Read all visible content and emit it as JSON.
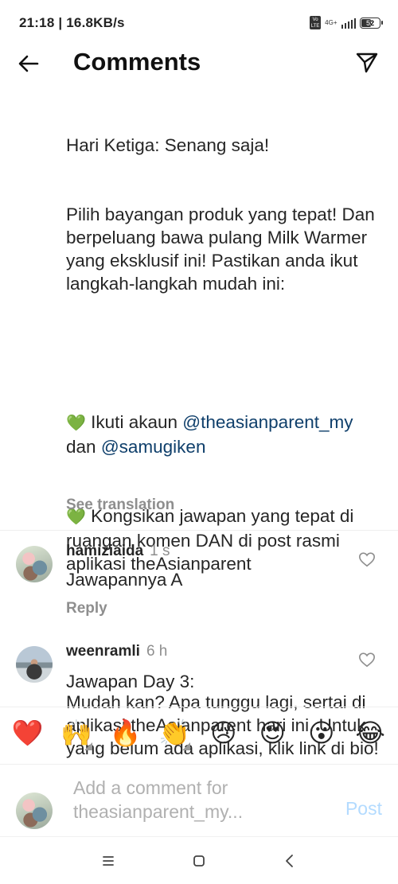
{
  "status": {
    "time_speed": "21:18 | 16.8KB/s",
    "network": "4G+",
    "battery": "52"
  },
  "header": {
    "title": "Comments"
  },
  "caption": {
    "line1": "Hari Ketiga: Senang saja!",
    "line2": "Pilih bayangan produk yang tepat! Dan berpeluang bawa pulang Milk Warmer yang eksklusif ini! Pastikan anda ikut langkah-langkah mudah ini:",
    "step1_prefix": "Ikuti akaun",
    "step1_mention1": "@theasianparent_my",
    "step1_mid": "dan",
    "step1_mention2": "@samugiken",
    "step2": "Kongsikan jawapan yang tepat di ruangan komen DAN di post rasmi aplikasi theAsianparent",
    "closing": "Mudah kan? Apa tunggu lagi, sertai di aplikasi theAsianparent hari ini. Untuk yang belum ada aplikasi, klik link di bio!",
    "see_translation": "See translation"
  },
  "comments": [
    {
      "username": "hamiziaida",
      "time": "1 s",
      "text": "Jawapannya A",
      "reply": "Reply"
    },
    {
      "username": "weenramli",
      "time": "6 h",
      "text": "Jawapan Day 3:"
    }
  ],
  "emoji_bar": [
    "❤️",
    "🙌",
    "🔥",
    "👏",
    "😢",
    "😍",
    "😮",
    "😂"
  ],
  "composer": {
    "placeholder": "Add a comment for theasianparent_my...",
    "post_label": "Post"
  },
  "colors": {
    "mention": "#0f3f6b",
    "post_disabled": "#b3dbff",
    "secondary_text": "#8e8e8e"
  }
}
